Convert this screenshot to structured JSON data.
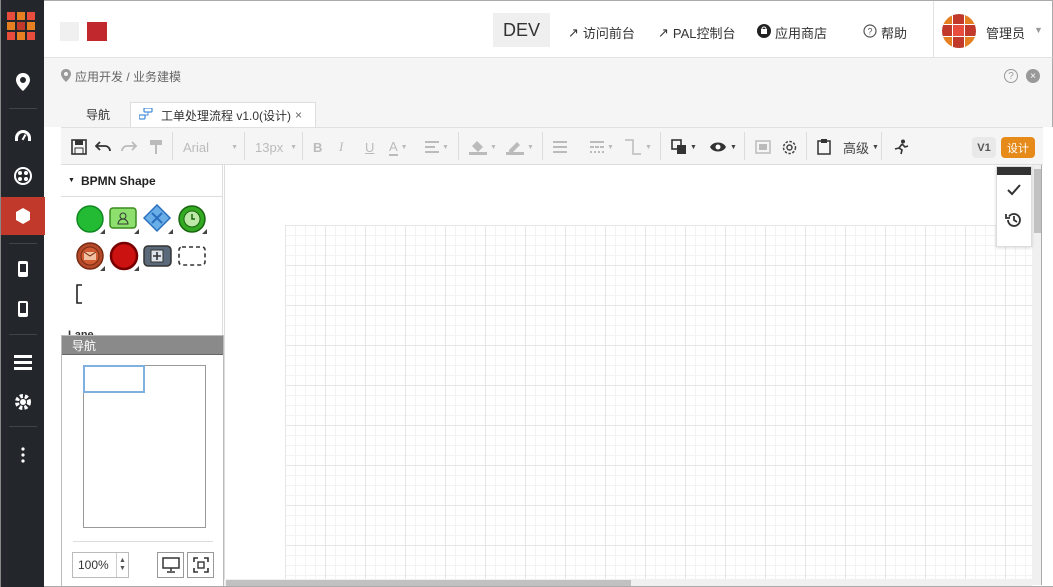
{
  "header": {
    "env_label": "DEV",
    "links": [
      {
        "label": "访问前台"
      },
      {
        "label": "PAL控制台"
      },
      {
        "label": "应用商店"
      },
      {
        "label": "帮助"
      }
    ],
    "user_name": "管理员"
  },
  "breadcrumb": {
    "text": "应用开发 / 业务建模"
  },
  "tabs": [
    {
      "label": "导航",
      "active": false
    },
    {
      "label": "工单处理流程 v1.0(设计)",
      "active": true,
      "close": "×"
    }
  ],
  "toolbar": {
    "font_family": "Arial",
    "font_size": "13px",
    "bold": "B",
    "italic": "I",
    "underline": "U",
    "font_color": "A",
    "advanced_label": "高级",
    "version_badge": "V1",
    "design_button": "设计"
  },
  "shape_panel": {
    "title": "BPMN Shape",
    "lane_label": "Lane"
  },
  "navigator": {
    "title": "导航",
    "zoom": "100%"
  },
  "colors": {
    "sidebar_bg": "#23272c",
    "sidebar_active": "#c0392b",
    "accent_orange": "#e68a1a",
    "brand_red": "#c0282d"
  }
}
